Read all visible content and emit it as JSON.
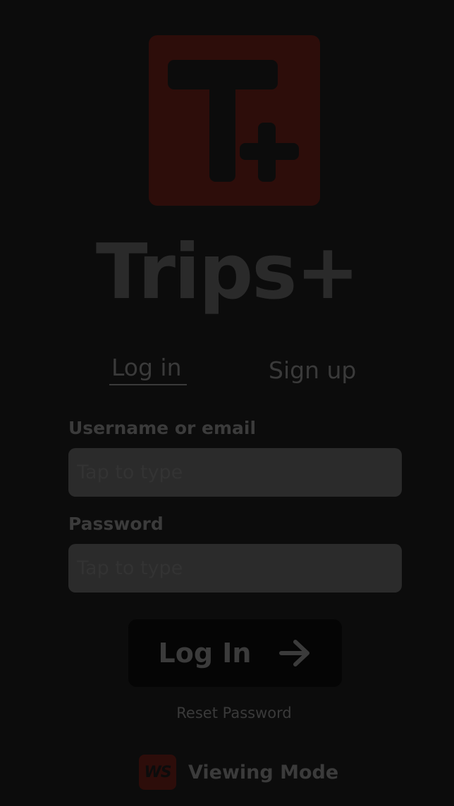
{
  "app": {
    "name": "Trips+",
    "logo_icon": "trips-plus-logo-icon"
  },
  "tabs": {
    "login_label": "Log in",
    "signup_label": "Sign up",
    "active": "login"
  },
  "form": {
    "username_label": "Username or email",
    "username_placeholder": "Tap to type",
    "username_value": "",
    "password_label": "Password",
    "password_placeholder": "Tap to type",
    "password_value": ""
  },
  "actions": {
    "login_label": "Log In",
    "login_icon": "arrow-right-icon",
    "reset_password_label": "Reset Password"
  },
  "footer": {
    "badge_text": "WS",
    "viewing_mode_label": "Viewing Mode"
  },
  "colors": {
    "background": "#0c0c0c",
    "logo_red_dimmed": "#2d0d0a",
    "text_dimmed": "#3b3b3b",
    "input_bg": "#2b2b2b"
  }
}
